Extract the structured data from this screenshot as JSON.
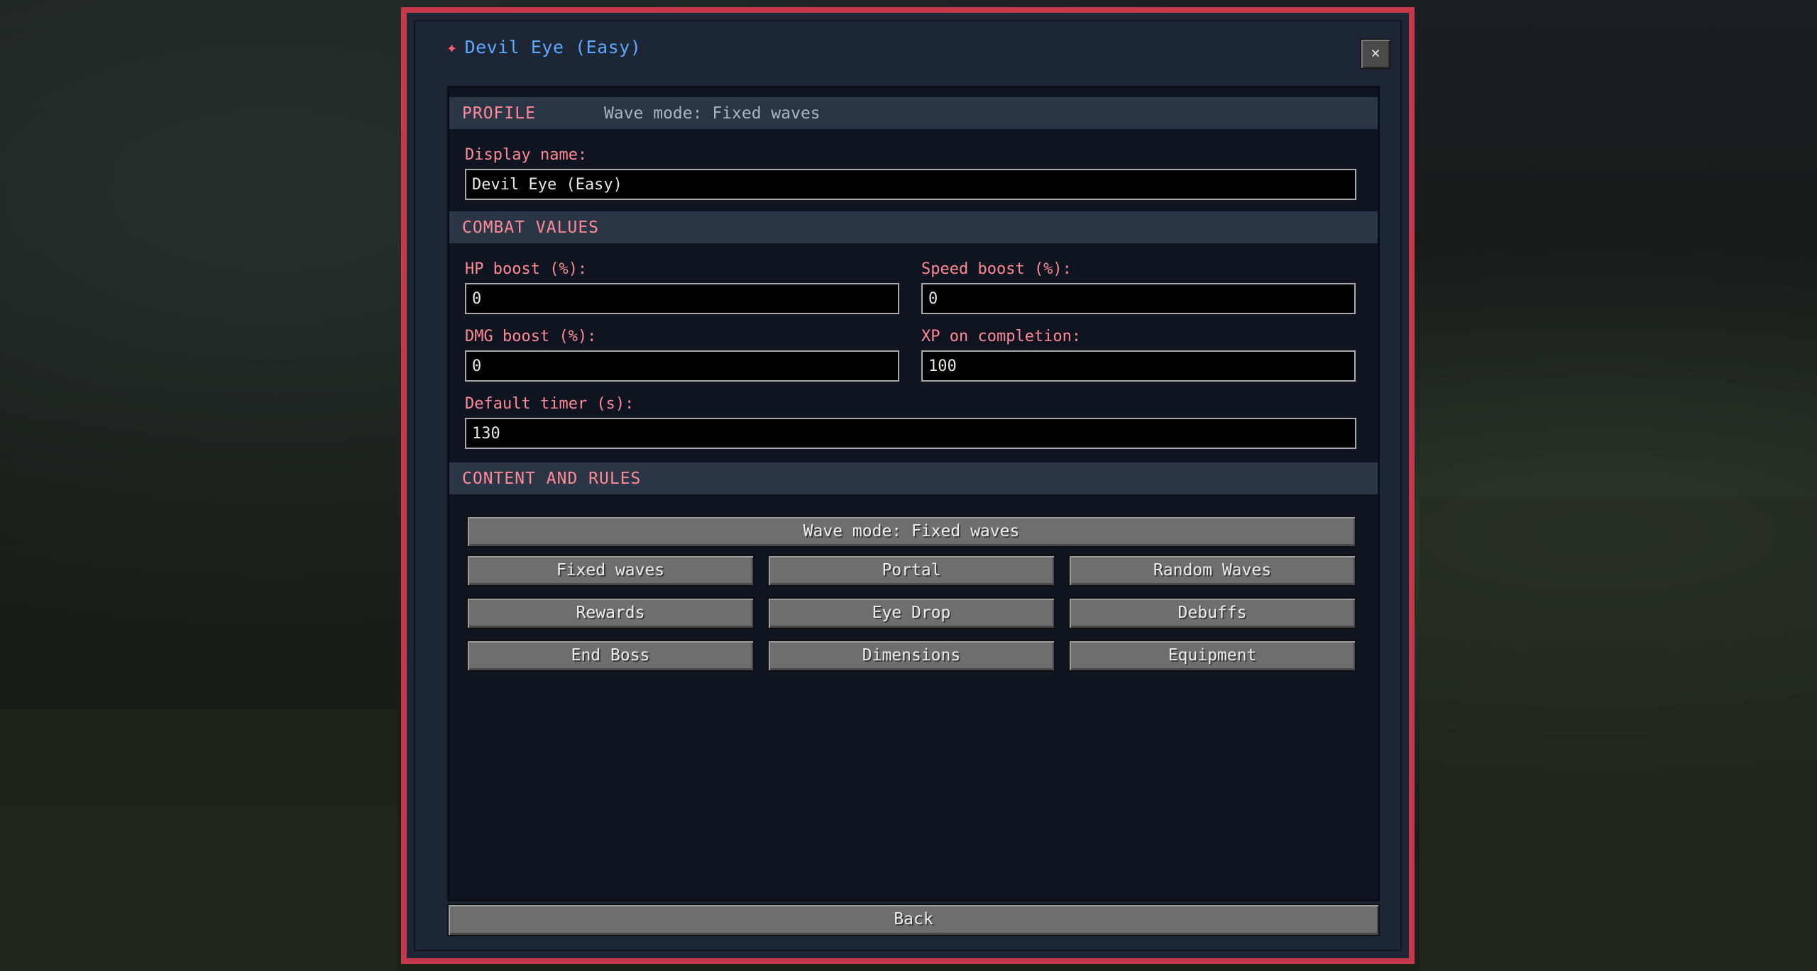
{
  "window": {
    "title": "Devil Eye (Easy)",
    "title_marker": "✦",
    "close_label": "×"
  },
  "profile": {
    "header": "PROFILE",
    "wave_mode_status": "Wave mode: Fixed waves",
    "display_name_label": "Display name:",
    "display_name_value": "Devil Eye (Easy)"
  },
  "combat": {
    "header": "COMBAT VALUES",
    "hp_boost_label": "HP boost (%):",
    "hp_boost_value": "0",
    "speed_boost_label": "Speed boost (%):",
    "speed_boost_value": "0",
    "dmg_boost_label": "DMG boost (%):",
    "dmg_boost_value": "0",
    "xp_label": "XP on completion:",
    "xp_value": "100",
    "timer_label": "Default timer (s):",
    "timer_value": "130"
  },
  "content": {
    "header": "CONTENT AND RULES",
    "wave_mode_button": "Wave mode: Fixed waves",
    "buttons": [
      "Fixed waves",
      "Portal",
      "Random Waves",
      "Rewards",
      "Eye Drop",
      "Debuffs",
      "End Boss",
      "Dimensions",
      "Equipment"
    ]
  },
  "footer": {
    "back_label": "Back"
  },
  "colors": {
    "frame_border": "#c4384a",
    "title_text": "#5ca9ff",
    "section_text": "#ff8a96",
    "button_face": "#6e6e6e"
  }
}
